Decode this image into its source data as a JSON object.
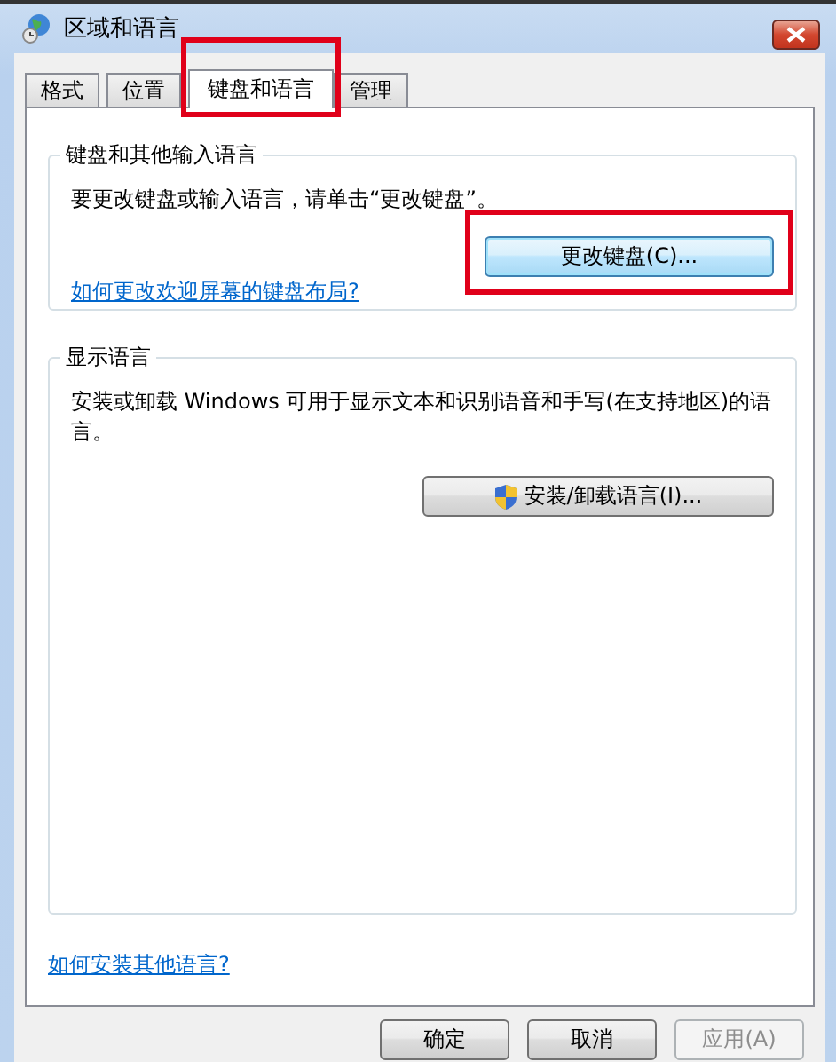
{
  "window": {
    "title": "区域和语言"
  },
  "tabs": [
    {
      "label": "格式",
      "selected": false,
      "highlighted": false
    },
    {
      "label": "位置",
      "selected": false,
      "highlighted": false
    },
    {
      "label": "键盘和语言",
      "selected": true,
      "highlighted": true
    },
    {
      "label": "管理",
      "selected": false,
      "highlighted": false
    }
  ],
  "groups": [
    {
      "title": "键盘和其他输入语言",
      "text": "要更改键盘或输入语言，请单击“更改键盘”。",
      "button": {
        "label": "更改键盘(C)...",
        "shield": false,
        "highlighted": true,
        "focused": true
      },
      "link": "如何更改欢迎屏幕的键盘布局?"
    },
    {
      "title": "显示语言",
      "text": "安装或卸载 Windows 可用于显示文本和识别语音和手写(在支持地区)的语言。",
      "button": {
        "label": "安装/卸载语言(I)...",
        "shield": true,
        "highlighted": false,
        "focused": false
      }
    }
  ],
  "footer_link": "如何安装其他语言?",
  "buttons": [
    {
      "label": "确定",
      "disabled": false
    },
    {
      "label": "取消",
      "disabled": false
    },
    {
      "label": "应用(A)",
      "disabled": true
    }
  ]
}
